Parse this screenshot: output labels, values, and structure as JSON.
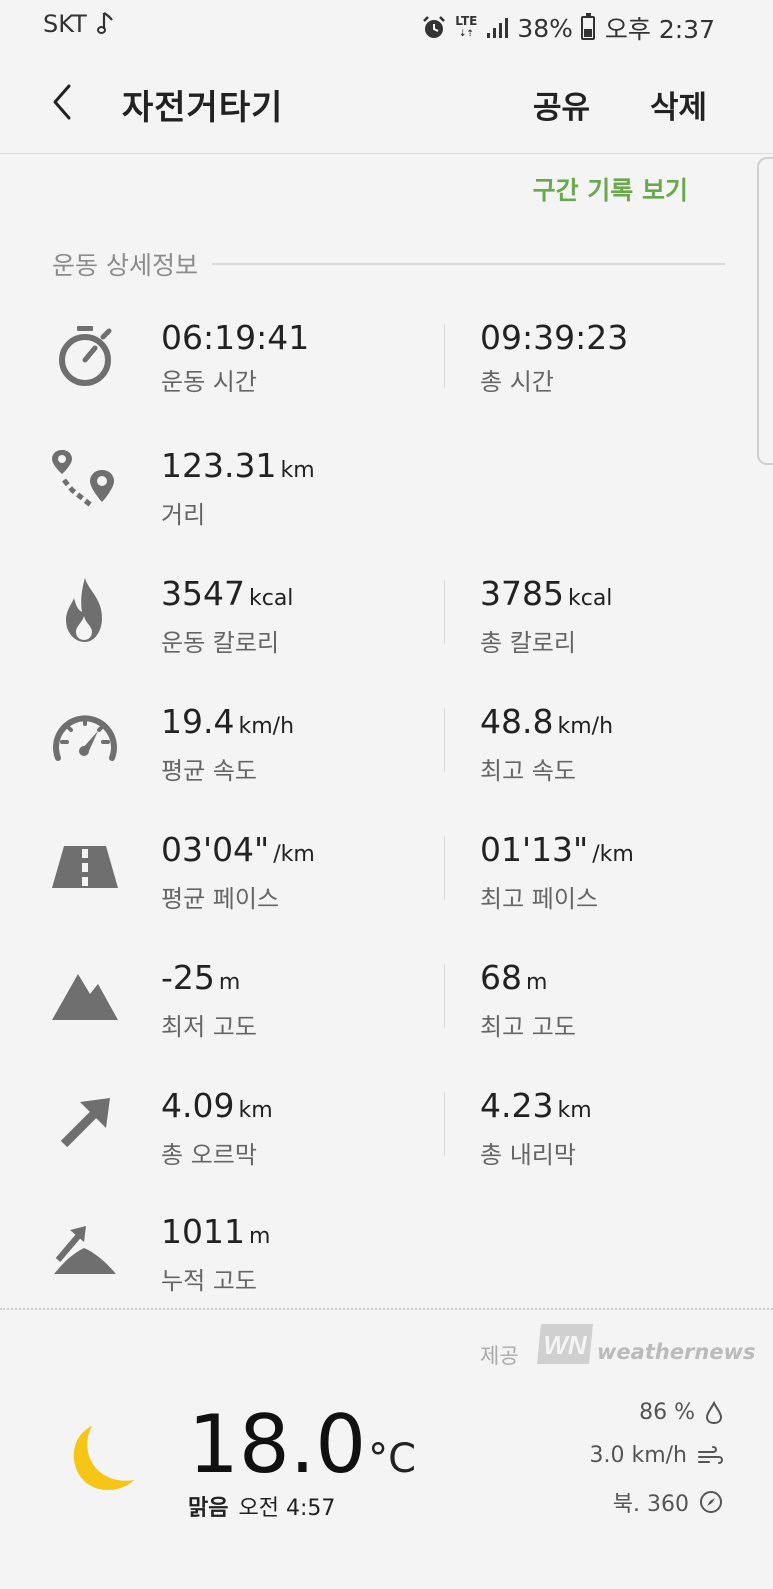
{
  "status_bar": {
    "carrier": "SKT",
    "network": "LTE",
    "battery": "38%",
    "battery_level": 0.38,
    "time": "오후 2:37"
  },
  "header": {
    "title": "자전거타기",
    "share_label": "공유",
    "delete_label": "삭제"
  },
  "records_link": "구간 기록 보기",
  "section_title": "운동 상세정보",
  "metrics": [
    {
      "icon": "stopwatch-icon",
      "left": {
        "value": "06:19:41",
        "unit": "",
        "label": "운동 시간"
      },
      "right": {
        "value": "09:39:23",
        "unit": "",
        "label": "총 시간"
      }
    },
    {
      "icon": "route-icon",
      "left": {
        "value": "123.31",
        "unit": "km",
        "label": "거리"
      }
    },
    {
      "icon": "flame-icon",
      "left": {
        "value": "3547",
        "unit": "kcal",
        "label": "운동 칼로리"
      },
      "right": {
        "value": "3785",
        "unit": "kcal",
        "label": "총 칼로리"
      }
    },
    {
      "icon": "speedometer-icon",
      "left": {
        "value": "19.4",
        "unit": "km/h",
        "label": "평균 속도"
      },
      "right": {
        "value": "48.8",
        "unit": "km/h",
        "label": "최고 속도"
      }
    },
    {
      "icon": "road-icon",
      "left": {
        "value": "03'04\"",
        "unit": "/km",
        "label": "평균 페이스"
      },
      "right": {
        "value": "01'13\"",
        "unit": "/km",
        "label": "최고 페이스"
      }
    },
    {
      "icon": "mountain-icon",
      "left": {
        "value": "-25",
        "unit": "m",
        "label": "최저 고도"
      },
      "right": {
        "value": "68",
        "unit": "m",
        "label": "최고 고도"
      }
    },
    {
      "icon": "uphill-arrow-icon",
      "left": {
        "value": "4.09",
        "unit": "km",
        "label": "총 오르막"
      },
      "right": {
        "value": "4.23",
        "unit": "km",
        "label": "총 내리막"
      }
    },
    {
      "icon": "cumulative-elevation-icon",
      "left": {
        "value": "1011",
        "unit": "m",
        "label": "누적 고도"
      }
    }
  ],
  "weather": {
    "provider_label": "제공",
    "provider_logo_text": "WN",
    "provider_name": "weathernews",
    "temperature": "18.0",
    "temperature_unit": "°C",
    "condition": "맑음",
    "time": "오전 4:57",
    "humidity": "86 %",
    "wind_speed": "3.0 km/h",
    "wind_direction": "북. 360",
    "icon": "moon-icon",
    "icon_color": "#f5c518"
  },
  "colors": {
    "accent_green": "#6aa84f",
    "icon_gray": "#6f6f6f",
    "background": "#f4f4f4"
  }
}
